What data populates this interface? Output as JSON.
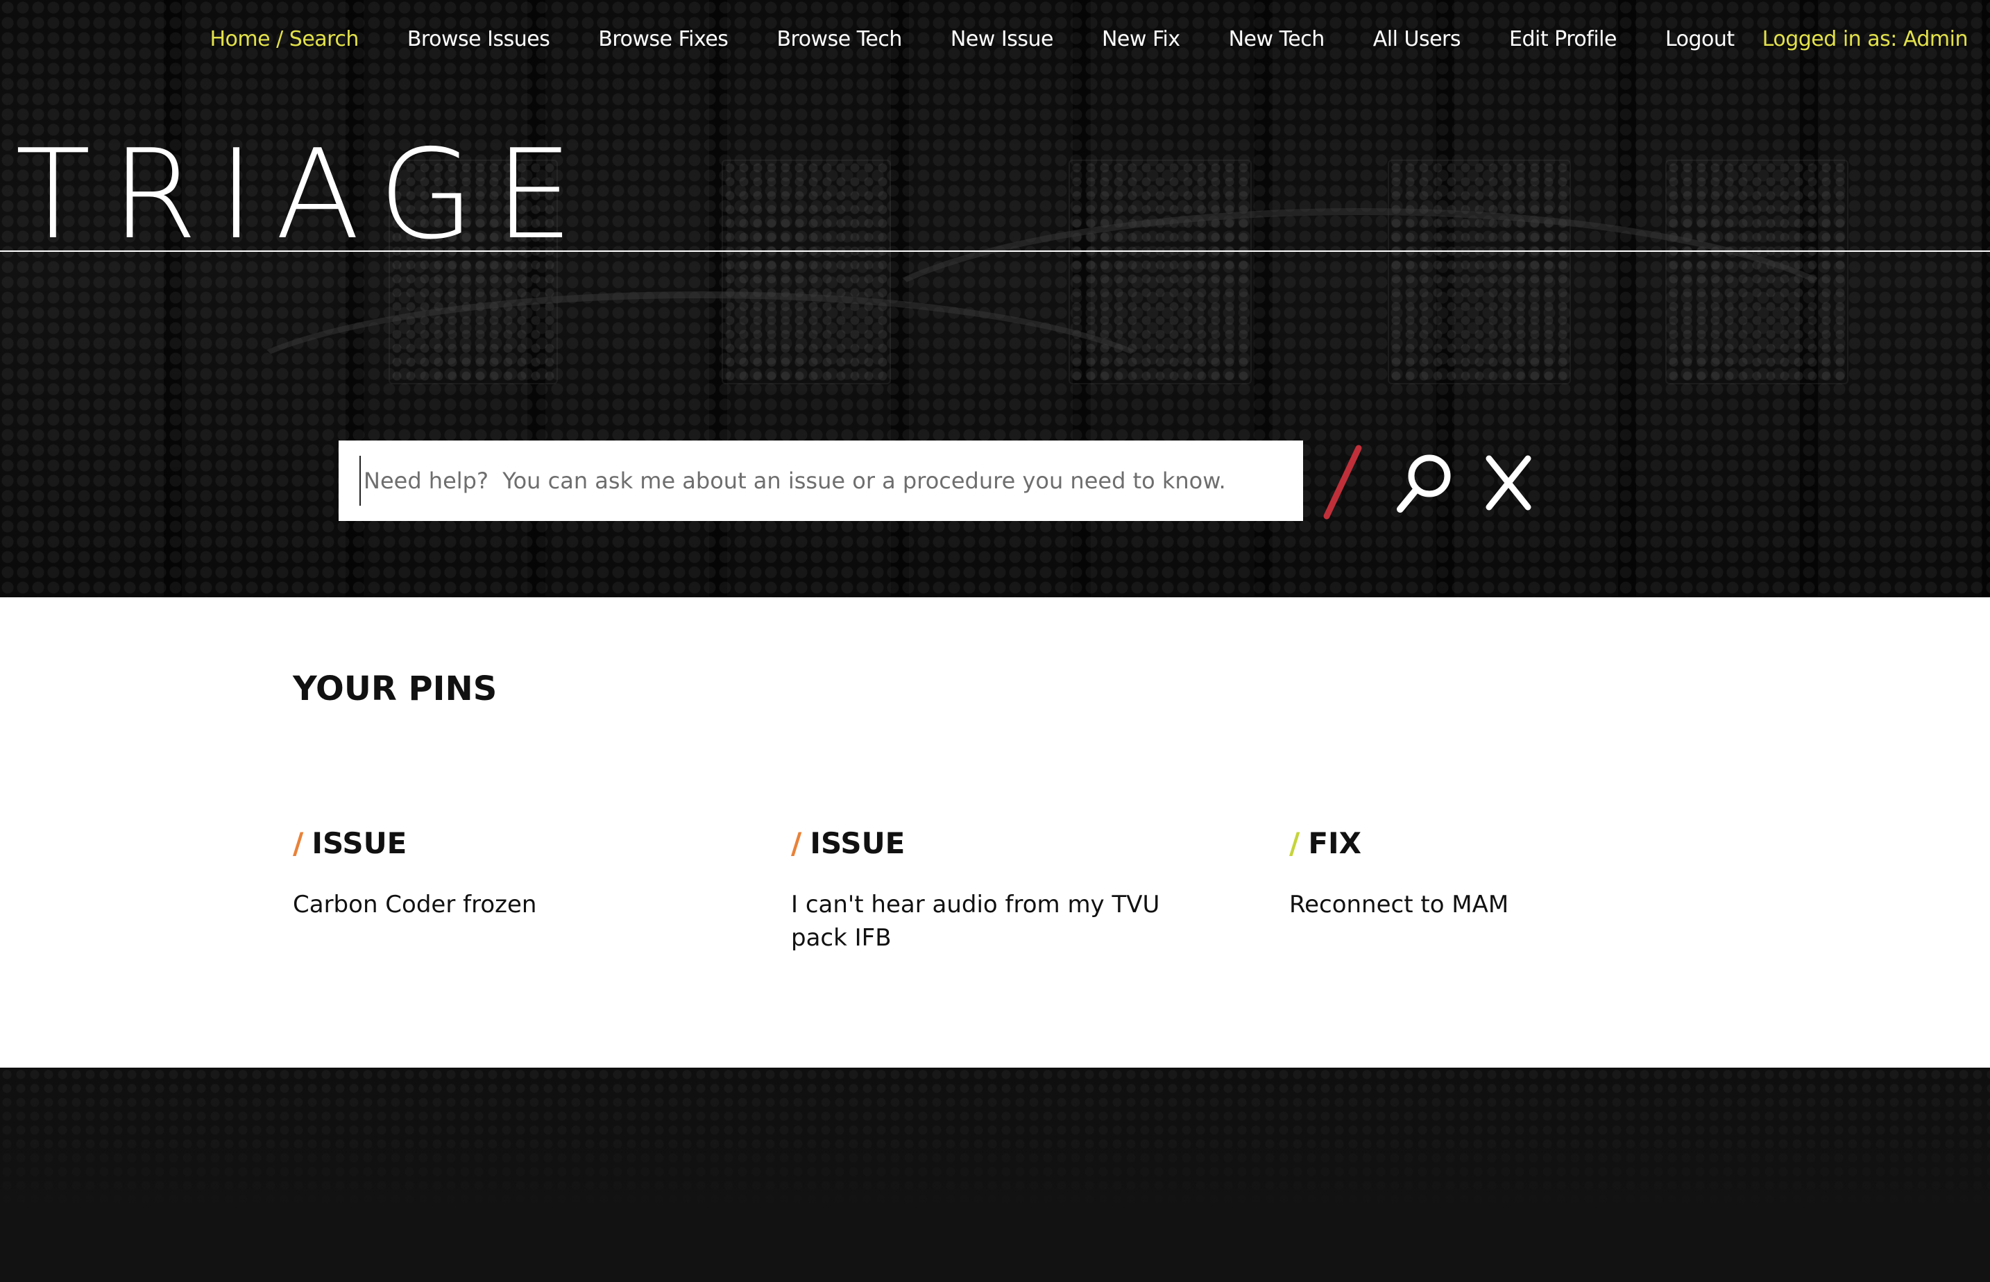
{
  "nav": {
    "items": [
      {
        "label": "Home / Search",
        "active": true
      },
      {
        "label": "Browse Issues",
        "active": false
      },
      {
        "label": "Browse Fixes",
        "active": false
      },
      {
        "label": "Browse Tech",
        "active": false
      },
      {
        "label": "New Issue",
        "active": false
      },
      {
        "label": "New Fix",
        "active": false
      },
      {
        "label": "New Tech",
        "active": false
      },
      {
        "label": "All Users",
        "active": false
      },
      {
        "label": "Edit Profile",
        "active": false
      },
      {
        "label": "Logout",
        "active": false
      }
    ],
    "user_label": "Logged in as: Admin"
  },
  "logo": {
    "text": "TRIAGE"
  },
  "search": {
    "value": "",
    "placeholder": "Need help?  You can ask me about an issue or a procedure you need to know.",
    "slash_color": "#c0303a",
    "icons": [
      "slash-icon",
      "magnifier-icon",
      "close-icon"
    ]
  },
  "pins": {
    "title": "YOUR PINS",
    "items": [
      {
        "slash": "/",
        "type": "ISSUE",
        "title": "Carbon Coder frozen",
        "color": "#e8823a"
      },
      {
        "slash": "/",
        "type": "ISSUE",
        "title": "I can't hear audio from my TVU pack IFB",
        "color": "#e8823a"
      },
      {
        "slash": "/",
        "type": "FIX",
        "title": "Reconnect to MAM",
        "color": "#c5d43a"
      }
    ]
  },
  "colors": {
    "accent_yellow": "#e3e24a",
    "issue_orange": "#e8823a",
    "fix_green": "#c5d43a",
    "search_red": "#c0303a"
  }
}
